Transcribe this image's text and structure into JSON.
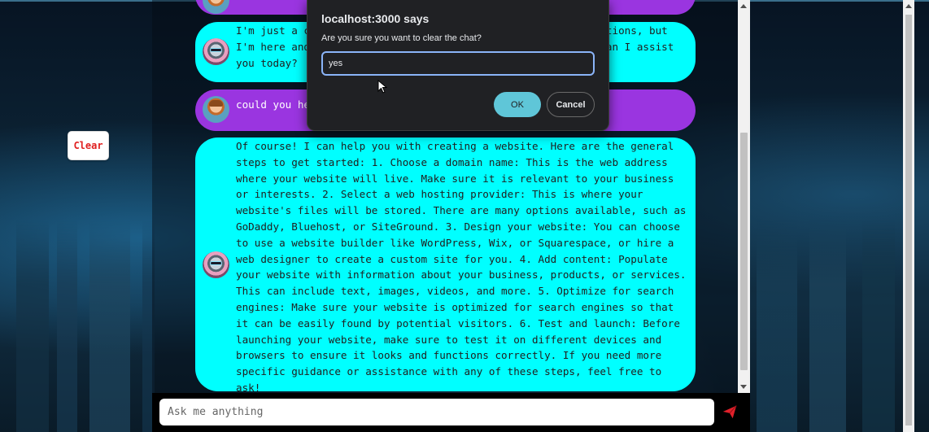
{
  "app": {
    "clear_label": "Clear"
  },
  "chat": {
    "messages": [
      {
        "role": "user",
        "text": ""
      },
      {
        "role": "bot",
        "text": "I'm just a computer program, so I don't have feelings or emotions, but I'm here and ready to help you with anything you need. How can I assist you today?"
      },
      {
        "role": "user",
        "text": "could you help me with creating a website"
      },
      {
        "role": "bot",
        "text": "Of course! I can help you with creating a website. Here are the general steps to get started: 1. Choose a domain name: This is the web address where your website will live. Make sure it is relevant to your business or interests. 2. Select a web hosting provider: This is where your website's files will be stored. There are many options available, such as GoDaddy, Bluehost, or SiteGround. 3. Design your website: You can choose to use a website builder like WordPress, Wix, or Squarespace, or hire a web designer to create a custom site for you. 4. Add content: Populate your website with information about your business, products, or services. This can include text, images, videos, and more. 5. Optimize for search engines: Make sure your website is optimized for search engines so that it can be easily found by potential visitors. 6. Test and launch: Before launching your website, make sure to test it on different devices and browsers to ensure it looks and functions correctly. If you need more specific guidance or assistance with any of these steps, feel free to ask!"
      }
    ],
    "input_placeholder": "Ask me anything"
  },
  "dialog": {
    "origin": "localhost:3000 says",
    "message": "Are you sure you want to clear the chat?",
    "input_value": "yes",
    "ok_label": "OK",
    "cancel_label": "Cancel"
  },
  "colors": {
    "bot_bubble": "#00ffff",
    "user_bubble": "#9a35e0",
    "clear_text": "#e02020",
    "send_icon": "#e0202a"
  },
  "icons": {
    "send": "send-icon",
    "bot_avatar": "robot-avatar-icon",
    "user_avatar": "user-avatar-icon"
  }
}
